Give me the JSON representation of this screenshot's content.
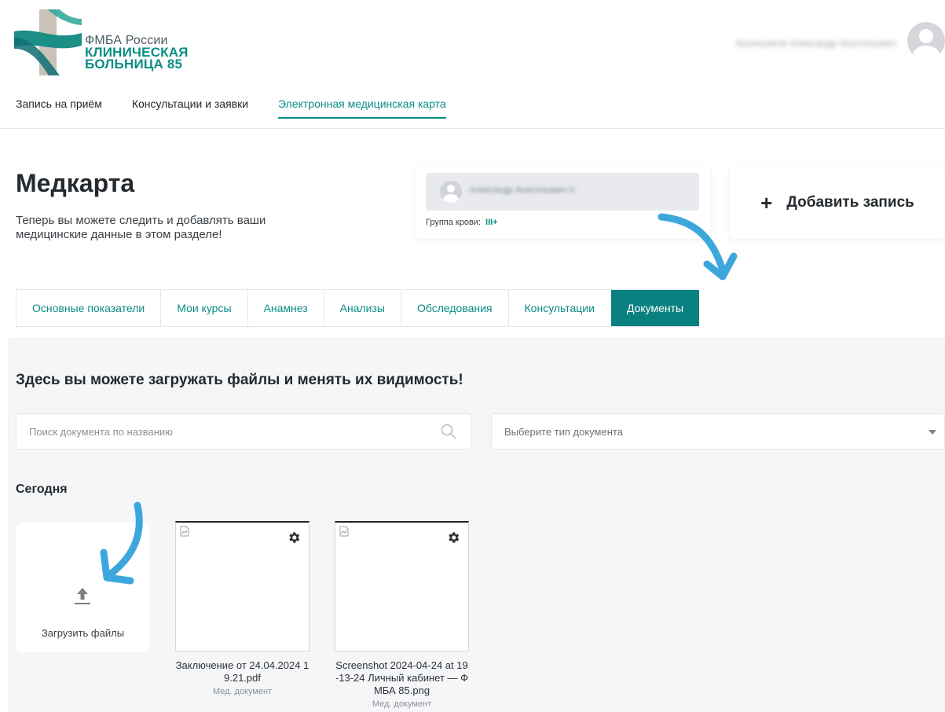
{
  "header": {
    "logo": {
      "line1": "ФМБА России",
      "line2": "КЛИНИЧЕСКАЯ",
      "line3": "БОЛЬНИЦА 85"
    },
    "user_name": "Калачьянов Александр Анатольевич"
  },
  "nav": {
    "items": [
      {
        "label": "Запись на приём"
      },
      {
        "label": "Консультации и заявки"
      },
      {
        "label": "Электронная медицинская карта"
      }
    ],
    "active_index": 2
  },
  "page": {
    "title": "Медкарта",
    "subtitle": "Теперь вы можете следить и добавлять ваши медицинские данные в этом разделе!"
  },
  "patient": {
    "name": "Александр Анатольевич К.",
    "blood_group_label": "Группа крови:",
    "blood_group_value": "III+"
  },
  "add_record": {
    "plus": "+",
    "label": "Добавить запись"
  },
  "tabs": [
    {
      "label": "Основные показатели"
    },
    {
      "label": "Мои курсы"
    },
    {
      "label": "Анамнез"
    },
    {
      "label": "Анализы"
    },
    {
      "label": "Обследования"
    },
    {
      "label": "Консультации"
    },
    {
      "label": "Документы",
      "active": true
    }
  ],
  "documents": {
    "heading": "Здесь вы можете загружать файлы и менять их видимость!",
    "search_placeholder": "Поиск документа по названию",
    "type_select_placeholder": "Выберите тип документа",
    "group_title": "Сегодня",
    "upload_label": "Загрузить файлы",
    "files": [
      {
        "name": "Заключение от 24.04.2024 19.21.pdf",
        "type": "Мед. документ"
      },
      {
        "name": "Screenshot 2024-04-24 at 19-13-24 Личный кабинет — ФМБА 85.png",
        "type": "Мед. документ"
      }
    ]
  },
  "colors": {
    "accent": "#0a8d86",
    "accent_dark": "#0a8181",
    "annotation_arrow": "#3da7dd",
    "panel_bg": "#f5f6f8"
  },
  "icons": [
    "logo-mark",
    "user-avatar-icon",
    "plus-icon",
    "search-icon",
    "chevron-down-icon",
    "upload-icon",
    "gear-icon",
    "broken-image-icon"
  ]
}
